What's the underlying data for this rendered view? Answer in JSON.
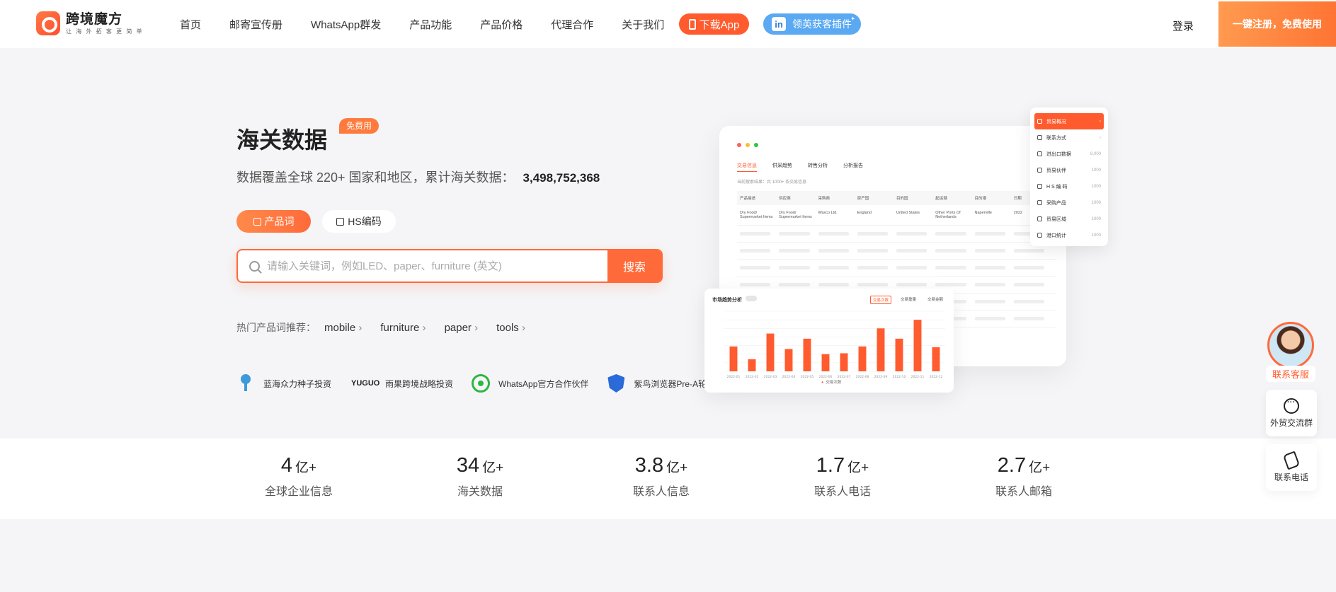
{
  "header": {
    "logo_name": "跨境魔方",
    "logo_slogan": "让 海 外 拓 客 更 简 单",
    "nav": [
      "首页",
      "邮寄宣传册",
      "WhatsApp群发",
      "产品功能",
      "产品价格",
      "代理合作",
      "关于我们"
    ],
    "download_app": "下载App",
    "linkedin_plugin": "领英获客插件",
    "login": "登录",
    "register": "一键注册，免费使用"
  },
  "hero": {
    "title": "海关数据",
    "badge": "免费用",
    "subtitle": "数据覆盖全球 220+ 国家和地区，累计海关数据：",
    "count": "3,498,752,368",
    "tab_product": "产品词",
    "tab_hs": "HS编码",
    "search_placeholder": "请输入关键词，例如LED、paper、furniture (英文)",
    "search_button": "搜索",
    "hot_label": "热门产品词推荐：",
    "hot_items": [
      "mobile",
      "furniture",
      "paper",
      "tools"
    ],
    "partners": [
      "蓝海众力种子投资",
      "雨果跨境战略投资",
      "WhatsApp官方合作伙伴",
      "紫鸟浏览器Pre-A轮"
    ],
    "partner_yuguo": "YUGUO"
  },
  "mockup": {
    "tabs": [
      "交易信息",
      "供采趋势",
      "转售分析",
      "分析报告"
    ],
    "note": "当前搜索结果：共 1000+ 条交易信息",
    "table_headers": [
      "产品描述",
      "供应商",
      "采购商",
      "原产国",
      "目的国",
      "起运港",
      "目的港",
      "日期"
    ],
    "table_row": [
      "Dry Food/ Supermarket Items",
      "Dry Food/ Supermarket Items",
      "Waxco Ltd.",
      "England",
      "United States",
      "Other Ports Of Netherlands",
      "Naperville",
      "2022"
    ],
    "side_items": [
      {
        "label": "贸易概况",
        "count": ""
      },
      {
        "label": "联系方式",
        "count": ""
      },
      {
        "label": "进出口数据",
        "count": "8,000"
      },
      {
        "label": "贸易伙伴",
        "count": "1000"
      },
      {
        "label": "H S 编 码",
        "count": "1000"
      },
      {
        "label": "采购产品",
        "count": "1000"
      },
      {
        "label": "贸易区域",
        "count": "1000"
      },
      {
        "label": "港口统计",
        "count": "1000"
      }
    ],
    "chart_title": "市场趋势分析",
    "chart_tabs": [
      "交易次数",
      "交易重量",
      "交易金额"
    ],
    "chart_legend": "交易次数"
  },
  "chart_data": {
    "type": "bar",
    "categories": [
      "2022-01",
      "2022-02",
      "2022-03",
      "2022-04",
      "2022-05",
      "2022-06",
      "2022-07",
      "2022-08",
      "2022-09",
      "2022-10",
      "2022-11",
      "2022-12"
    ],
    "values": [
      290,
      140,
      440,
      260,
      380,
      200,
      210,
      290,
      500,
      380,
      600,
      280
    ],
    "ylim": [
      0,
      700
    ],
    "colors": {
      "bar": "#ff5b2e"
    }
  },
  "stats": [
    {
      "num": "4",
      "unit": "亿+",
      "label": "全球企业信息"
    },
    {
      "num": "34",
      "unit": "亿+",
      "label": "海关数据"
    },
    {
      "num": "3.8",
      "unit": "亿+",
      "label": "联系人信息"
    },
    {
      "num": "1.7",
      "unit": "亿+",
      "label": "联系人电话"
    },
    {
      "num": "2.7",
      "unit": "亿+",
      "label": "联系人邮箱"
    }
  ],
  "floating": {
    "service": "联系客服",
    "group": "外贸交流群",
    "phone": "联系电话"
  },
  "colors": {
    "accent": "#ff5b2e",
    "linkedin": "#5aa9f2"
  }
}
